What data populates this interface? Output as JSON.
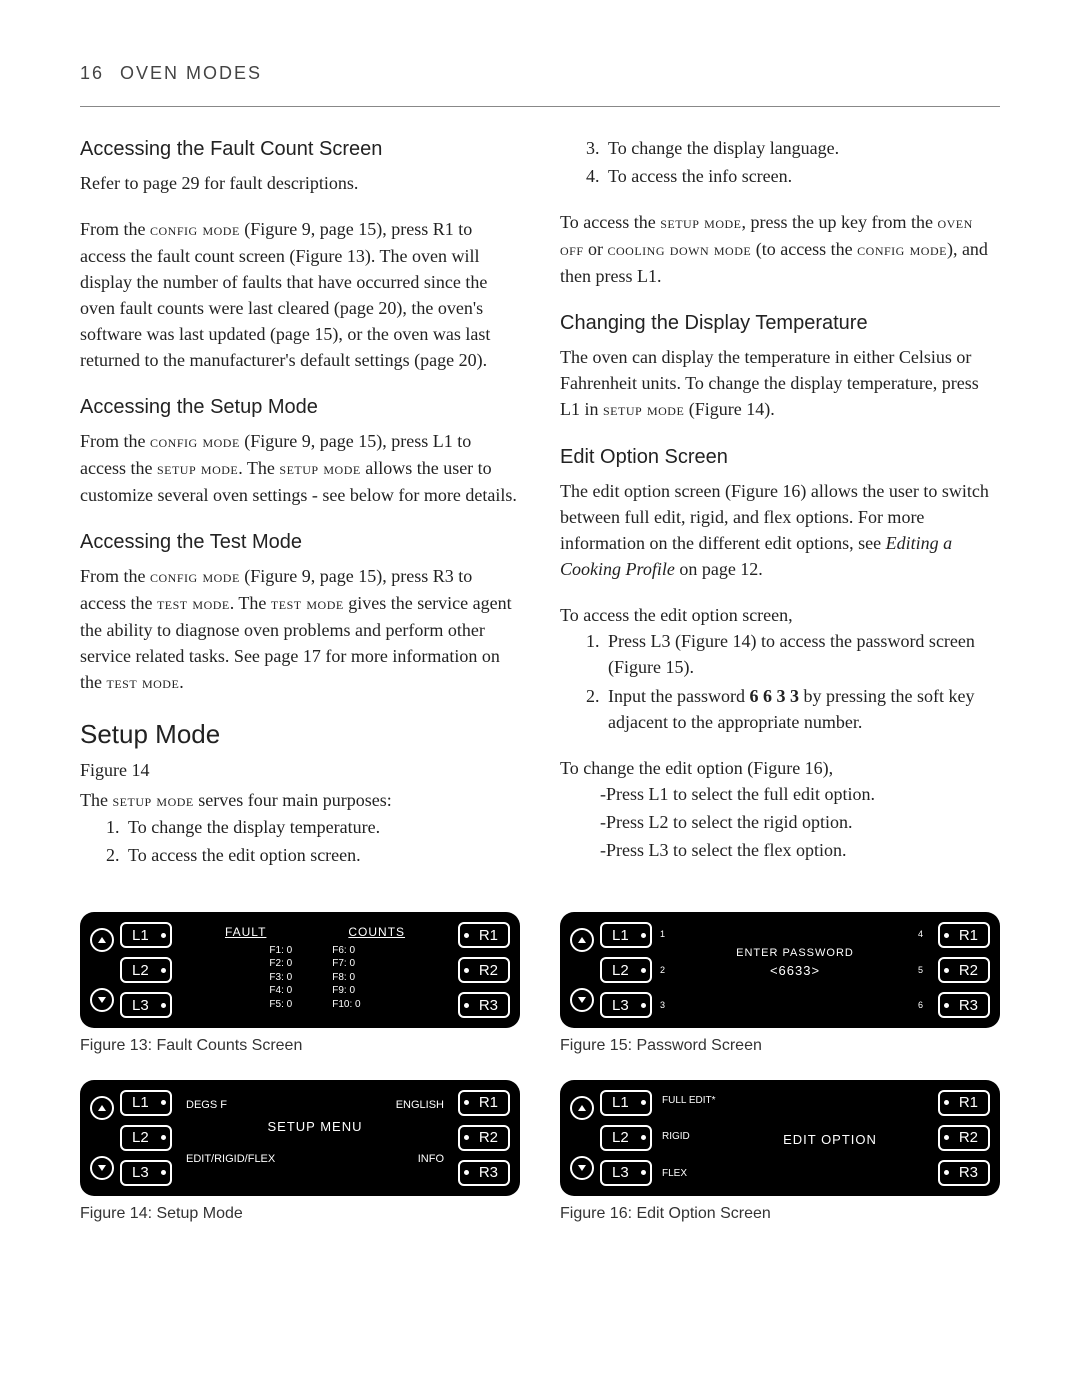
{
  "header": {
    "page": "16",
    "title": "OVEN MODES"
  },
  "left": {
    "h1": "Accessing the Fault Count Screen",
    "p1": "Refer to page 29 for fault descriptions.",
    "p2a": "From the ",
    "p2sc1": "config mode",
    "p2b": " (Figure 9, page 15), press R1 to access the fault count screen (Figure 13). The oven will display the number of faults that have occurred since the oven fault counts were last cleared (page 20), the oven's software was last updated (page 15), or the oven was last returned to the manufacturer's default settings (page 20).",
    "h2": "Accessing the Setup Mode",
    "p3a": "From the ",
    "p3sc1": "config mode",
    "p3b": " (Figure 9, page 15), press L1 to access the ",
    "p3sc2": "setup mode",
    "p3c": ". The ",
    "p3sc3": "setup mode",
    "p3d": " allows the user to customize several oven settings - see below for more details.",
    "h3": "Accessing the Test Mode",
    "p4a": "From the ",
    "p4sc1": "config mode",
    "p4b": " (Figure 9, page 15), press R3 to access the ",
    "p4sc2": "test mode",
    "p4c": ". The ",
    "p4sc3": "test mode",
    "p4d": " gives the service agent the ability to diagnose oven problems and perform other service related tasks. See page 17 for more information on the ",
    "p4sc4": "test mode",
    "p4e": ".",
    "h4": "Setup Mode",
    "p5": "Figure 14",
    "p6a": "The ",
    "p6sc1": "setup mode",
    "p6b": " serves four main purposes:",
    "li1": "To change the display temperature.",
    "li2": "To access the edit option screen."
  },
  "right": {
    "li3": "To change the display language.",
    "li4": "To access the info screen.",
    "p1a": "To access the ",
    "p1sc1": "setup mode",
    "p1b": ", press the up key from the ",
    "p1sc2": "oven off",
    "p1c": " or ",
    "p1sc3": "cooling down mode",
    "p1d": " (to access the ",
    "p1sc4": "config mode",
    "p1e": "), and then press L1.",
    "h1": "Changing the Display Temperature",
    "p2a": "The oven can display the temperature in either Celsius or Fahrenheit units. To change the display temperature, press L1 in ",
    "p2sc1": "setup mode",
    "p2b": " (Figure 14).",
    "h2": "Edit Option Screen",
    "p3a": "The edit option screen (Figure 16) allows the user to switch between full edit, rigid, and flex options. For more information on the different edit options, see ",
    "p3it": "Editing a Cooking Profile",
    "p3b": " on page 12.",
    "p4": "To access the edit option screen,",
    "li5": "Press L3 (Figure 14) to access the password screen (Figure 15).",
    "li6a": "Input the password ",
    "li6b": "6 6 3 3",
    "li6c": " by pressing the soft key adjacent to the appropriate number.",
    "p5": "To change the edit option (Figure 16),",
    "sub1": "-Press L1 to select the full edit option.",
    "sub2": "-Press L2 to select the rigid option.",
    "sub3": "-Press L3 to select the flex option."
  },
  "fig13": {
    "caption": "Figure 13: Fault Counts Screen",
    "keys": {
      "L1": "L1",
      "L2": "L2",
      "L3": "L3",
      "R1": "R1",
      "R2": "R2",
      "R3": "R3"
    },
    "title1": "FAULT",
    "title2": "COUNTS",
    "col1": [
      "F1: 0",
      "F2: 0",
      "F3: 0",
      "F4: 0",
      "F5: 0"
    ],
    "col2": [
      "F6: 0",
      "F7: 0",
      "F8: 0",
      "F9: 0",
      "F10: 0"
    ]
  },
  "fig14": {
    "caption": "Figure 14: Setup Mode",
    "title": "SETUP MENU",
    "r1l": "DEGS F",
    "r1r": "ENGLISH",
    "r3l": "EDIT/RIGID/FLEX",
    "r3r": "INFO"
  },
  "fig15": {
    "caption": "Figure 15: Password Screen",
    "title": "ENTER PASSWORD",
    "value": "<6633>",
    "leftnums": [
      "1",
      "2",
      "3"
    ],
    "rightnums": [
      "4",
      "5",
      "6"
    ]
  },
  "fig16": {
    "caption": "Figure 16: Edit Option Screen",
    "title": "EDIT OPTION",
    "opts": [
      "FULL EDIT*",
      "RIGID",
      "FLEX"
    ]
  }
}
